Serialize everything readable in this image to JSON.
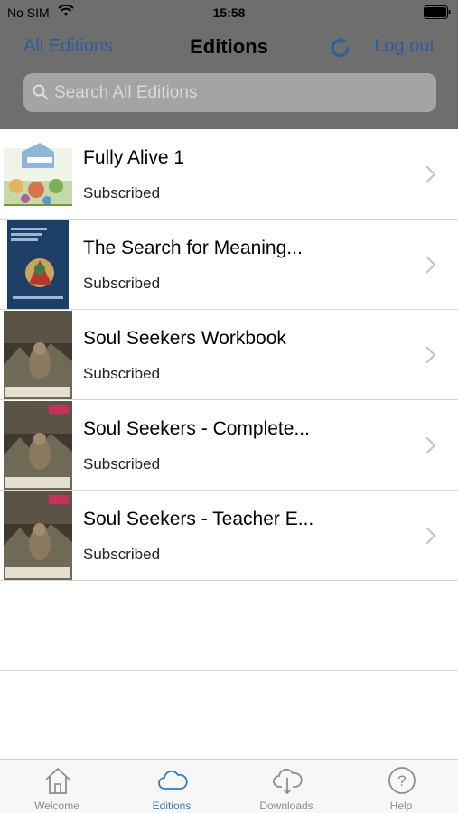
{
  "status_bar": {
    "carrier": "No SIM",
    "time": "15:58"
  },
  "nav": {
    "left_label": "All Editions",
    "title": "Editions",
    "right_label": "Log out"
  },
  "search": {
    "placeholder": "Search All Editions"
  },
  "editions": [
    {
      "title": "Fully Alive 1",
      "status": "Subscribed"
    },
    {
      "title": "The Search for Meaning...",
      "status": "Subscribed"
    },
    {
      "title": "Soul Seekers Workbook",
      "status": "Subscribed"
    },
    {
      "title": "Soul Seekers - Complete...",
      "status": "Subscribed"
    },
    {
      "title": "Soul Seekers - Teacher E...",
      "status": "Subscribed"
    }
  ],
  "tabs": [
    {
      "label": "Welcome",
      "icon": "home-icon"
    },
    {
      "label": "Editions",
      "icon": "cloud-icon",
      "active": true
    },
    {
      "label": "Downloads",
      "icon": "cloud-download-icon"
    },
    {
      "label": "Help",
      "icon": "help-icon"
    }
  ],
  "colors": {
    "accent": "#2f7dd1",
    "dim_overlay": "#6e6e6e"
  }
}
